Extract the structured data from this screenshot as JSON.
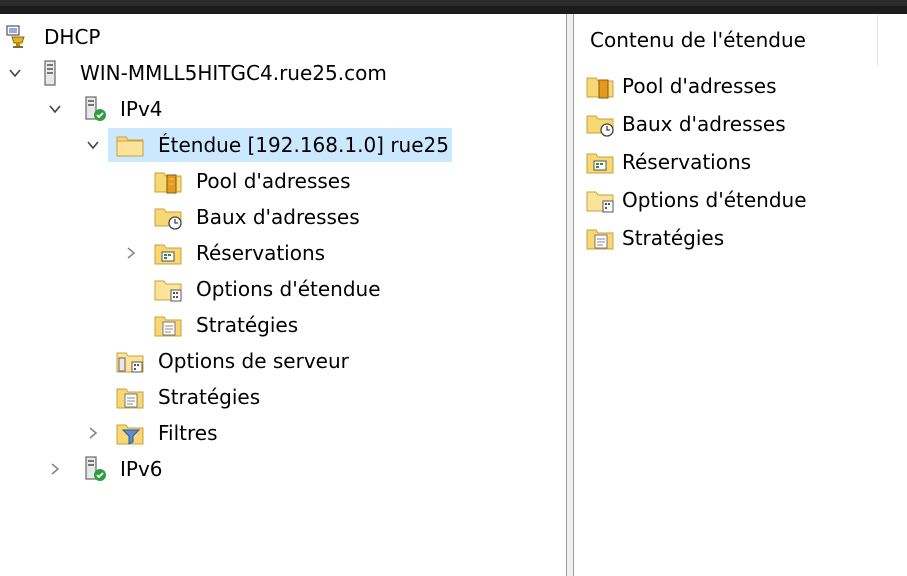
{
  "tree": {
    "root": "DHCP",
    "server": "WIN-MMLL5HITGC4.rue25.com",
    "ipv4": "IPv4",
    "scope": "Étendue [192.168.1.0] rue25",
    "scope_children": [
      "Pool d'adresses",
      "Baux d'adresses",
      "Réservations",
      "Options d'étendue",
      "Stratégies"
    ],
    "server_options": "Options de serveur",
    "policies": "Stratégies",
    "filters": "Filtres",
    "ipv6": "IPv6"
  },
  "detail": {
    "header": "Contenu de l'étendue",
    "items": [
      "Pool d'adresses",
      "Baux d'adresses",
      "Réservations",
      "Options d'étendue",
      "Stratégies"
    ]
  }
}
